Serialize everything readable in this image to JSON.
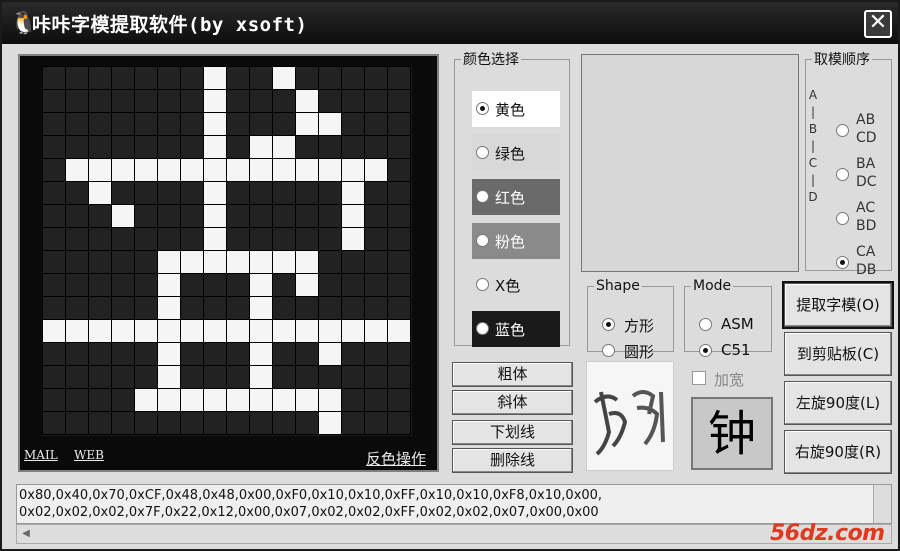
{
  "window": {
    "title": "咔咔字模提取软件(by xsoft)",
    "close_label": "✕",
    "app_icon": "penguin-icon"
  },
  "grid": {
    "size": 16,
    "bits": [
      "0000000100100000",
      "0000000100010000",
      "0000000100011000",
      "0000000101100000",
      "0111111111111110",
      "0010000100000100",
      "0001000100000100",
      "0000000100000100",
      "0000011111110000",
      "0000010001010000",
      "0000010001000000",
      "1111111111111111",
      "0000010001001000",
      "0000010001000000",
      "0000111111111000",
      "0000000000001000"
    ],
    "links": {
      "mail": "MAIL",
      "web": "WEB",
      "invert": "反色操作"
    }
  },
  "color_group": {
    "legend": "颜色选择",
    "options": [
      {
        "label": "黄色",
        "selected": true,
        "bg": "#ffffff"
      },
      {
        "label": "绿色",
        "selected": false,
        "bg": "#d8d8d8"
      },
      {
        "label": "红色",
        "selected": false,
        "bg": "#6a6a6a"
      },
      {
        "label": "粉色",
        "selected": false,
        "bg": "#8a8a8a"
      },
      {
        "label": "X色",
        "selected": false,
        "bg": "#dcdcdc"
      },
      {
        "label": "蓝色",
        "selected": false,
        "bg": "#1a1a1a"
      }
    ]
  },
  "order_group": {
    "legend": "取模顺序",
    "abcd": [
      "A",
      "|",
      "B",
      "|",
      "C",
      "|",
      "D"
    ],
    "options": [
      {
        "line1": "AB",
        "line2": "CD",
        "selected": false
      },
      {
        "line1": "BA",
        "line2": "DC",
        "selected": false
      },
      {
        "line1": "AC",
        "line2": "BD",
        "selected": false
      },
      {
        "line1": "CA",
        "line2": "DB",
        "selected": true
      }
    ]
  },
  "shape_group": {
    "legend": "Shape",
    "options": [
      {
        "label": "方形",
        "selected": true
      },
      {
        "label": "圆形",
        "selected": false
      }
    ]
  },
  "mode_group": {
    "legend": "Mode",
    "options": [
      {
        "label": "ASM",
        "selected": false
      },
      {
        "label": "C51",
        "selected": true
      }
    ]
  },
  "style_buttons": [
    "粗体",
    "斜体",
    "下划线",
    "删除线"
  ],
  "widen": {
    "label": "加宽",
    "checked": false
  },
  "char_preview": "钟",
  "actions": [
    "提取字模(O)",
    "到剪贴板(C)",
    "左旋90度(L)",
    "右旋90度(R)"
  ],
  "output": {
    "line1": "0x80,0x40,0x70,0xCF,0x48,0x48,0x00,0xF0,0x10,0x10,0xFF,0x10,0x10,0xF8,0x10,0x00,",
    "line2": "0x02,0x02,0x02,0x7F,0x22,0x12,0x00,0x07,0x02,0x02,0xFF,0x02,0x02,0x07,0x00,0x00"
  },
  "watermark": "56dz.com"
}
